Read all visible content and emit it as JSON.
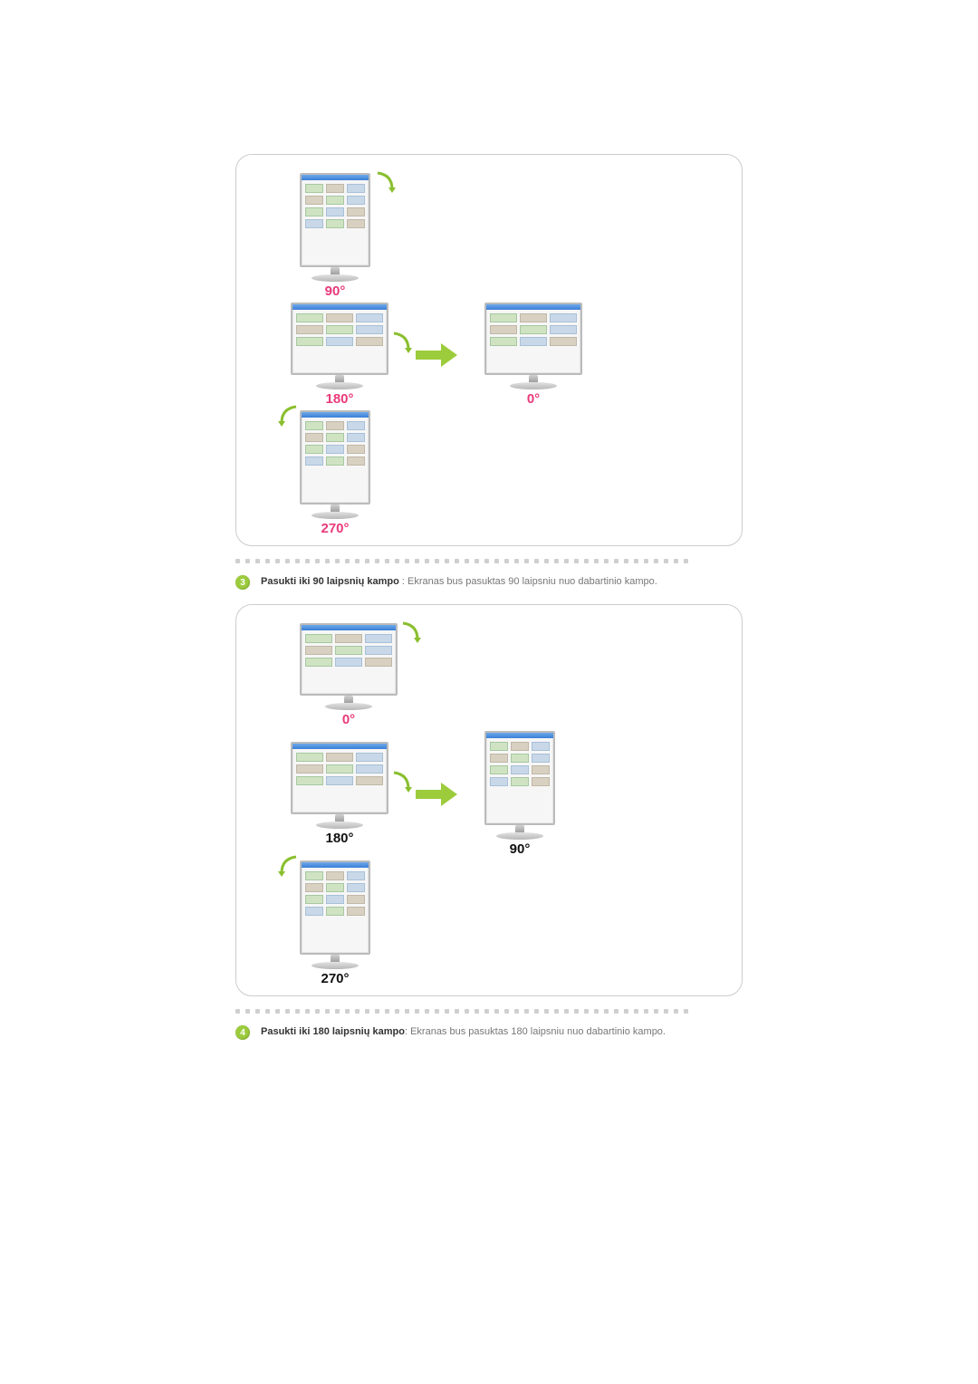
{
  "fig1": {
    "top": {
      "deg": "90°",
      "colorClass": "pink"
    },
    "left": {
      "deg": "180°",
      "colorClass": "pink"
    },
    "right": {
      "deg": "0°",
      "colorClass": "pink"
    },
    "bottom": {
      "deg": "270°",
      "colorClass": "pink"
    }
  },
  "caption1": {
    "num": "3",
    "bold": "Pasukti iki 90 laipsnių kampo",
    "sep": " : ",
    "rest": "Ekranas bus pasuktas 90 laipsniu nuo dabartinio kampo."
  },
  "fig2": {
    "top": {
      "deg": "0°",
      "colorClass": "pink"
    },
    "left": {
      "deg": "180°",
      "colorClass": "black"
    },
    "right": {
      "deg": "90°",
      "colorClass": "black"
    },
    "bottom": {
      "deg": "270°",
      "colorClass": "black"
    }
  },
  "caption2": {
    "num": "4",
    "bold": "Pasukti iki 180 laipsnių kampo",
    "sep": ": ",
    "rest": "Ekranas bus pasuktas 180 laipsniu nuo dabartinio kampo."
  }
}
